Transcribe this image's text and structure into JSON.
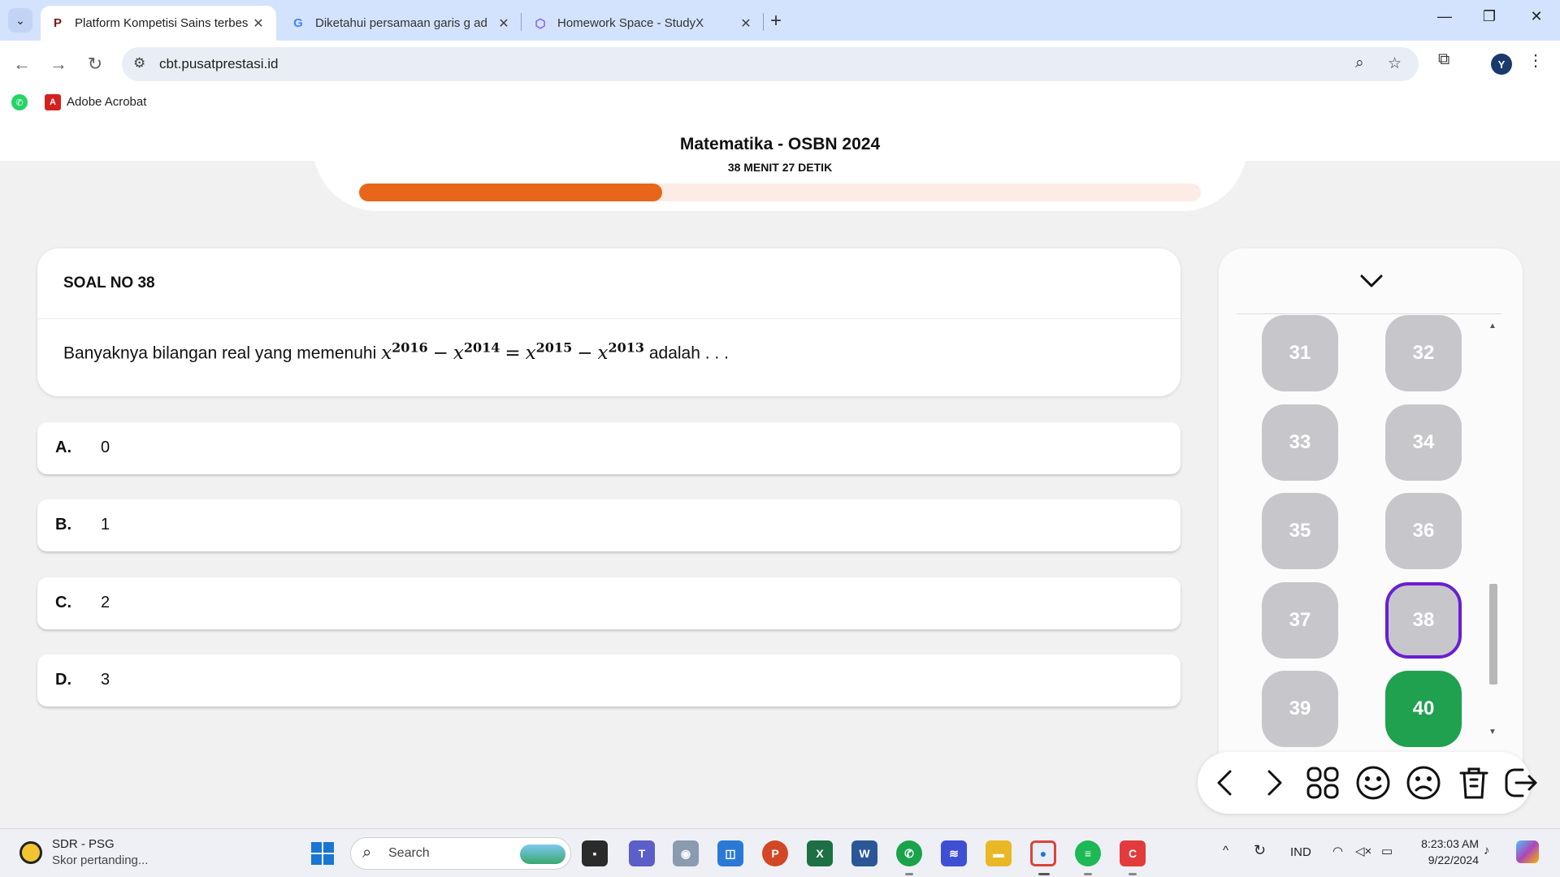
{
  "browser": {
    "tabs": [
      {
        "title": "Platform Kompetisi Sains terbes",
        "active": true,
        "icon": "pusatprestasi-logo-icon"
      },
      {
        "title": "Diketahui persamaan garis g ad",
        "active": false,
        "icon": "google-icon"
      },
      {
        "title": "Homework Space - StudyX",
        "active": false,
        "icon": "studyx-icon"
      }
    ],
    "url": "cbt.pusatprestasi.id",
    "profile_initial": "Y",
    "bookmarks": [
      {
        "label": "",
        "icon": "whatsapp-icon"
      },
      {
        "label": "Adobe Acrobat",
        "icon": "acrobat-icon"
      }
    ]
  },
  "exam": {
    "title": "Matematika - OSBN 2024",
    "timer": "38 MENIT 27 DETIK",
    "progress_fraction": 0.36,
    "colors": {
      "progress": "#e8661a",
      "progress_track": "#fdece6",
      "answered": "#1fa14f",
      "current_border": "#6a1fd1",
      "unanswered": "#c7c7cb"
    }
  },
  "question": {
    "number_label": "SOAL NO 38",
    "text_before": "Banyaknya bilangan real yang memenuhi",
    "math": {
      "terms": [
        {
          "base": "x",
          "exp": "2016"
        },
        {
          "op": "−"
        },
        {
          "base": "x",
          "exp": "2014"
        },
        {
          "op": "="
        },
        {
          "base": "x",
          "exp": "2015"
        },
        {
          "op": "−"
        },
        {
          "base": "x",
          "exp": "2013"
        }
      ]
    },
    "text_after": "adalah . . ."
  },
  "options": [
    {
      "letter": "A.",
      "text": "0"
    },
    {
      "letter": "B.",
      "text": "1"
    },
    {
      "letter": "C.",
      "text": "2"
    },
    {
      "letter": "D.",
      "text": "3"
    }
  ],
  "navigator": {
    "questions": [
      {
        "label": "31",
        "state": "unanswered"
      },
      {
        "label": "32",
        "state": "unanswered"
      },
      {
        "label": "33",
        "state": "unanswered"
      },
      {
        "label": "34",
        "state": "unanswered"
      },
      {
        "label": "35",
        "state": "unanswered"
      },
      {
        "label": "36",
        "state": "unanswered"
      },
      {
        "label": "37",
        "state": "unanswered"
      },
      {
        "label": "38",
        "state": "current"
      },
      {
        "label": "39",
        "state": "unanswered"
      },
      {
        "label": "40",
        "state": "answered"
      }
    ],
    "actions": [
      "previous-icon",
      "next-icon",
      "grid-icon",
      "smile-icon",
      "sad-icon",
      "trash-icon",
      "exit-icon"
    ]
  },
  "taskbar": {
    "news_title": "SDR - PSG",
    "news_subtitle": "Skor pertanding...",
    "search_label": "Search",
    "language": "IND",
    "time": "8:23:03 AM",
    "date": "9/22/2024"
  }
}
